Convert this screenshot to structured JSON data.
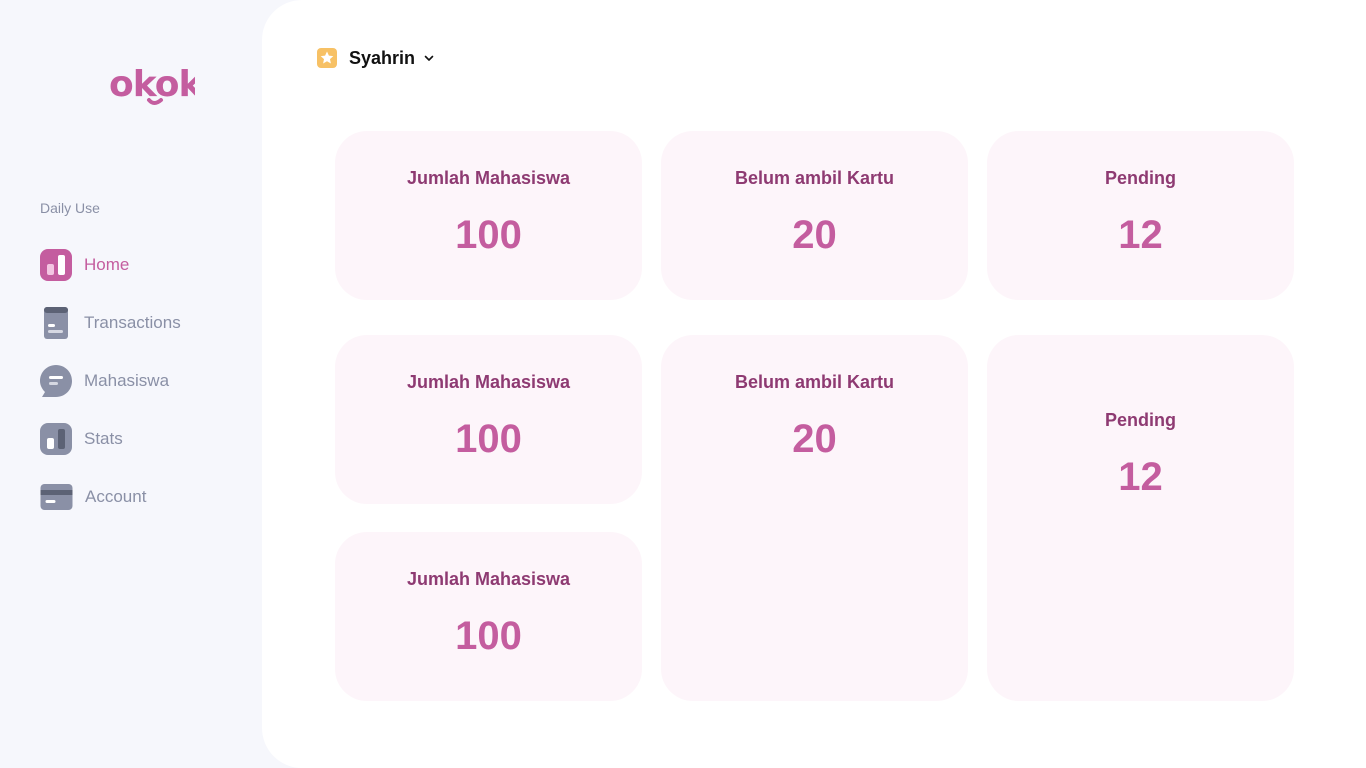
{
  "app": {
    "logo_text": "okok",
    "brand_color": "#c45d9f"
  },
  "sidebar": {
    "section_label": "Daily Use",
    "items": [
      {
        "label": "Home",
        "icon": "chart-icon",
        "active": true
      },
      {
        "label": "Transactions",
        "icon": "receipt-icon",
        "active": false
      },
      {
        "label": "Mahasiswa",
        "icon": "chat-icon",
        "active": false
      },
      {
        "label": "Stats",
        "icon": "stats-icon",
        "active": false
      },
      {
        "label": "Account",
        "icon": "card-icon",
        "active": false
      }
    ]
  },
  "header": {
    "user_name": "Syahrin",
    "user_icon": "star-icon",
    "dropdown_icon": "chevron-down-icon"
  },
  "cards": [
    {
      "title": "Jumlah Mahasiswa",
      "value": "100"
    },
    {
      "title": "Belum ambil Kartu",
      "value": "20"
    },
    {
      "title": "Pending",
      "value": "12"
    },
    {
      "title": "Jumlah Mahasiswa",
      "value": "100"
    },
    {
      "title": "Belum ambil Kartu",
      "value": "20"
    },
    {
      "title": "Pending",
      "value": "12"
    },
    {
      "title": "Jumlah Mahasiswa",
      "value": "100"
    }
  ]
}
